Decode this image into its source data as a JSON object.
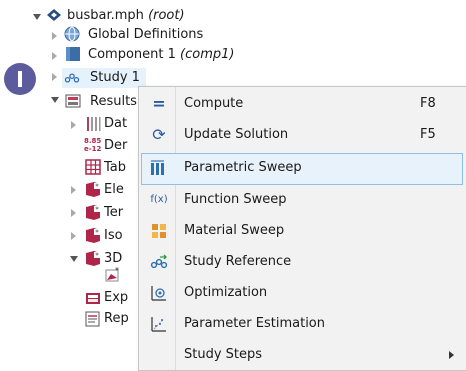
{
  "tree": {
    "root": {
      "label": "busbar.mph",
      "suffix": "(root)"
    },
    "global_definitions": {
      "label": "Global Definitions"
    },
    "component": {
      "label": "Component 1",
      "suffix": "(comp1)"
    },
    "study": {
      "label": "Study 1"
    },
    "results": {
      "label": "Results"
    },
    "children": [
      {
        "label": "Dat",
        "icon": "data-sets-icon"
      },
      {
        "label": "Der",
        "icon": "derived-values-icon"
      },
      {
        "label": "Tab",
        "icon": "tables-icon"
      },
      {
        "label": "Ele",
        "icon": "plot-group-icon"
      },
      {
        "label": "Ter",
        "icon": "plot-group-icon"
      },
      {
        "label": "Iso",
        "icon": "plot-group-icon"
      },
      {
        "label": "3D",
        "icon": "plot-group-icon"
      },
      {
        "label": "Exp",
        "icon": "export-icon"
      },
      {
        "label": "Rep",
        "icon": "reports-icon"
      }
    ]
  },
  "context_menu": {
    "items": [
      {
        "label": "Compute",
        "shortcut": "F8",
        "icon": "compute-icon"
      },
      {
        "label": "Update Solution",
        "shortcut": "F5",
        "icon": "update-solution-icon"
      },
      {
        "label": "Parametric Sweep",
        "shortcut": "",
        "icon": "parametric-sweep-icon"
      },
      {
        "label": "Function Sweep",
        "shortcut": "",
        "icon": "function-sweep-icon"
      },
      {
        "label": "Material Sweep",
        "shortcut": "",
        "icon": "material-sweep-icon"
      },
      {
        "label": "Study Reference",
        "shortcut": "",
        "icon": "study-reference-icon"
      },
      {
        "label": "Optimization",
        "shortcut": "",
        "icon": "optimization-icon"
      },
      {
        "label": "Parameter Estimation",
        "shortcut": "",
        "icon": "parameter-estimation-icon"
      },
      {
        "label": "Study Steps",
        "shortcut": "",
        "icon": ""
      }
    ],
    "highlighted_index": 2
  },
  "icon_text": {
    "function_sweep": "f(x)",
    "derived_values_top": "8.85",
    "derived_values_bottom": "e-12"
  },
  "colors": {
    "highlight_bg": "#e8f2fb",
    "highlight_border": "#8ec1ea",
    "badge": "#5b5b9e",
    "menu_bg": "#f2f2f2"
  }
}
